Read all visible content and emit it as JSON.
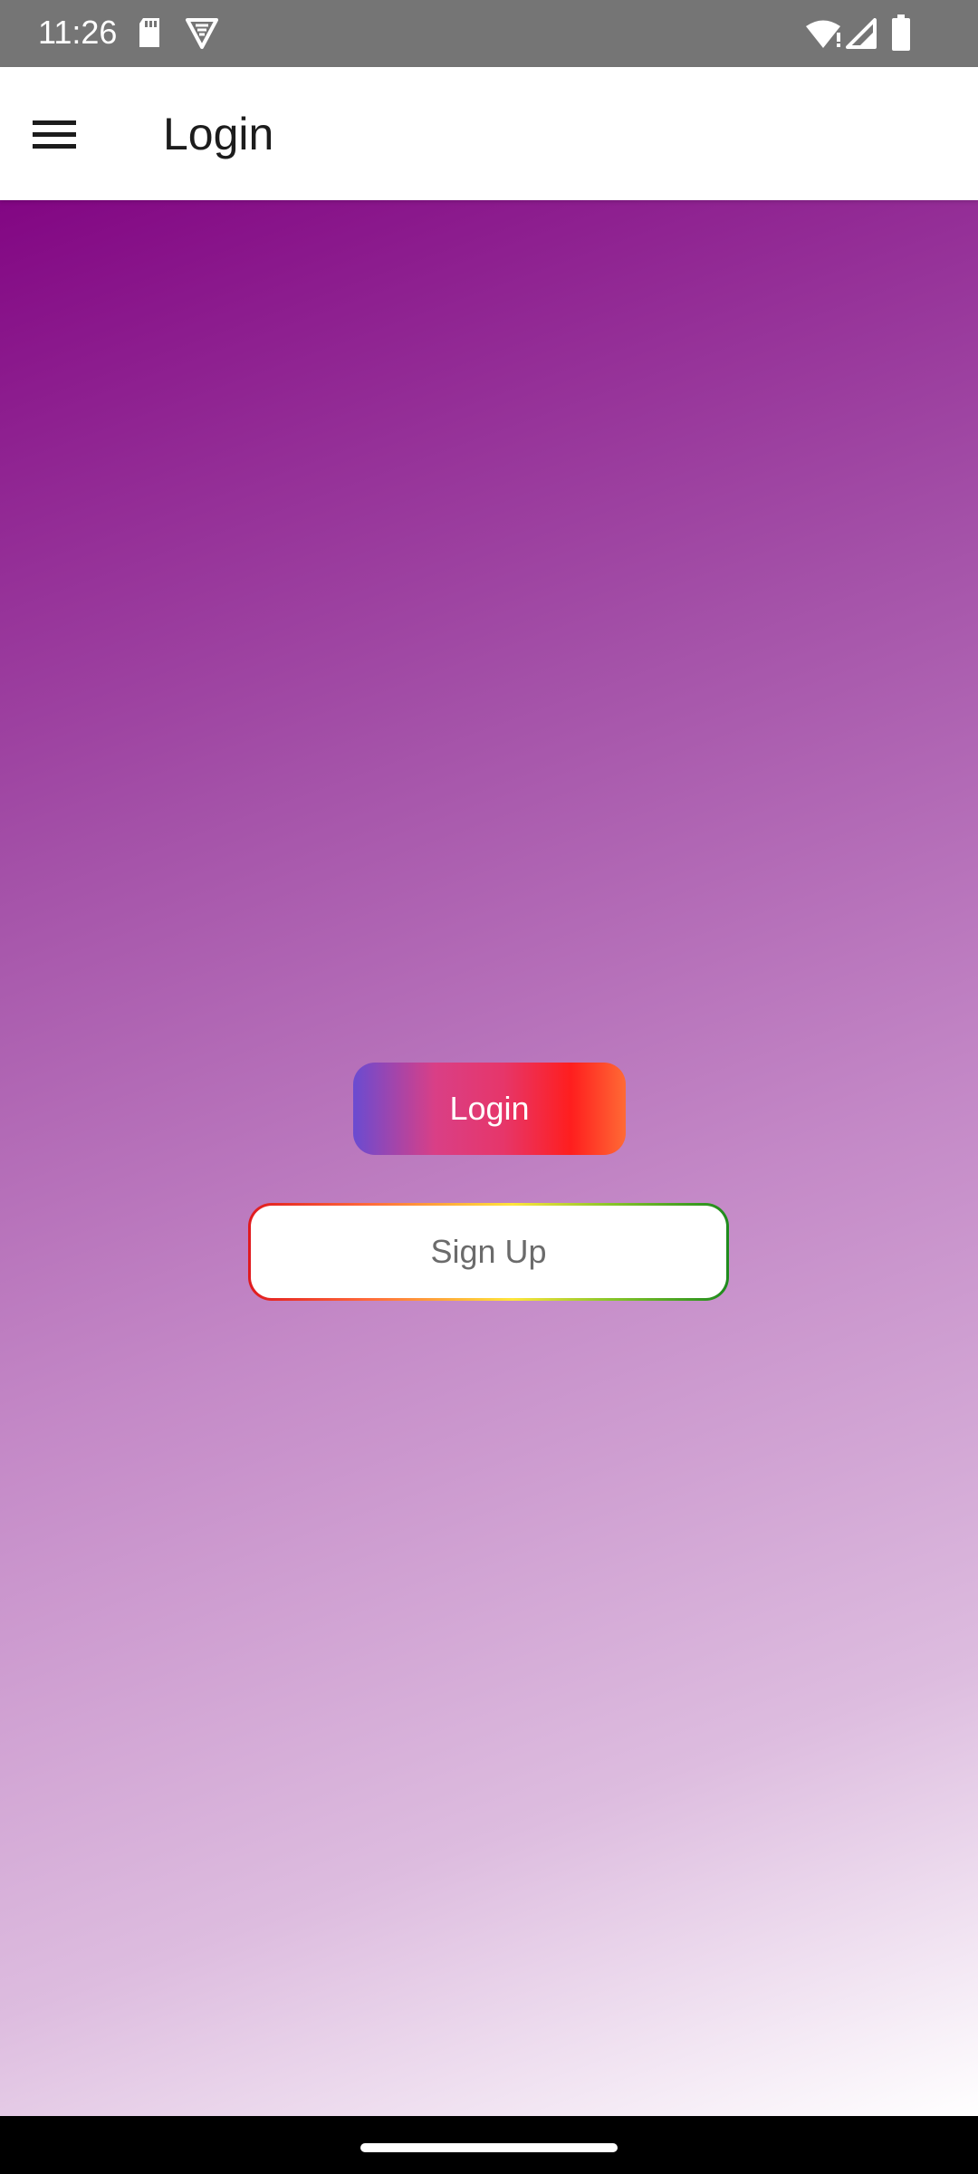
{
  "status_bar": {
    "time": "11:26",
    "icons": [
      "sd-card-icon",
      "vpn-shield-icon",
      "wifi-alert-icon",
      "signal-icon",
      "battery-icon"
    ]
  },
  "app_bar": {
    "menu_icon": "hamburger-menu-icon",
    "title": "Login"
  },
  "main": {
    "background_gradient": [
      "#820683",
      "#a451a8",
      "#c489c7",
      "#ddbcdf",
      "#ffffff"
    ],
    "login_button_label": "Login",
    "signup_button_label": "Sign Up"
  },
  "colors": {
    "status_bar": "#757575",
    "app_bar": "#ffffff",
    "title_text": "#1c1c1c",
    "signup_text": "#6b6b6b"
  }
}
